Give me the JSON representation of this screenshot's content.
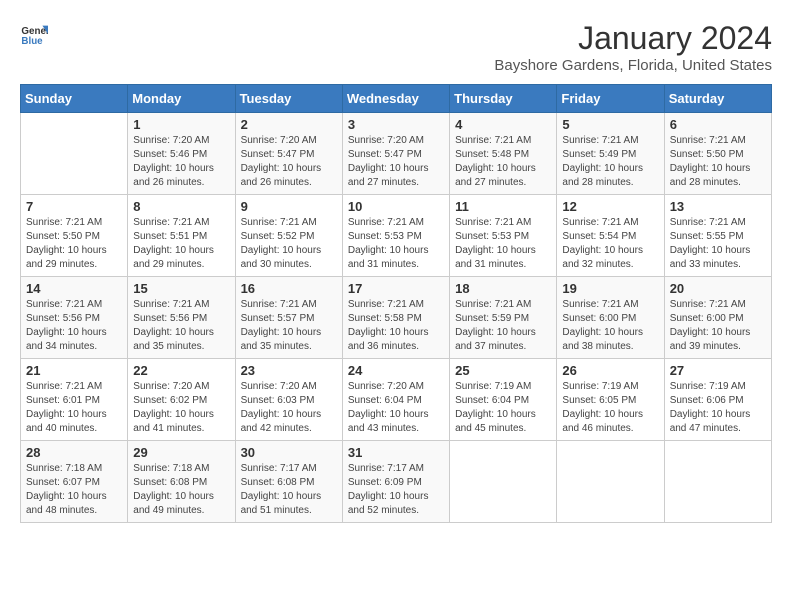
{
  "header": {
    "logo_general": "General",
    "logo_blue": "Blue",
    "month": "January 2024",
    "location": "Bayshore Gardens, Florida, United States"
  },
  "weekdays": [
    "Sunday",
    "Monday",
    "Tuesday",
    "Wednesday",
    "Thursday",
    "Friday",
    "Saturday"
  ],
  "weeks": [
    [
      {
        "day": "",
        "info": ""
      },
      {
        "day": "1",
        "info": "Sunrise: 7:20 AM\nSunset: 5:46 PM\nDaylight: 10 hours\nand 26 minutes."
      },
      {
        "day": "2",
        "info": "Sunrise: 7:20 AM\nSunset: 5:47 PM\nDaylight: 10 hours\nand 26 minutes."
      },
      {
        "day": "3",
        "info": "Sunrise: 7:20 AM\nSunset: 5:47 PM\nDaylight: 10 hours\nand 27 minutes."
      },
      {
        "day": "4",
        "info": "Sunrise: 7:21 AM\nSunset: 5:48 PM\nDaylight: 10 hours\nand 27 minutes."
      },
      {
        "day": "5",
        "info": "Sunrise: 7:21 AM\nSunset: 5:49 PM\nDaylight: 10 hours\nand 28 minutes."
      },
      {
        "day": "6",
        "info": "Sunrise: 7:21 AM\nSunset: 5:50 PM\nDaylight: 10 hours\nand 28 minutes."
      }
    ],
    [
      {
        "day": "7",
        "info": "Sunrise: 7:21 AM\nSunset: 5:50 PM\nDaylight: 10 hours\nand 29 minutes."
      },
      {
        "day": "8",
        "info": "Sunrise: 7:21 AM\nSunset: 5:51 PM\nDaylight: 10 hours\nand 29 minutes."
      },
      {
        "day": "9",
        "info": "Sunrise: 7:21 AM\nSunset: 5:52 PM\nDaylight: 10 hours\nand 30 minutes."
      },
      {
        "day": "10",
        "info": "Sunrise: 7:21 AM\nSunset: 5:53 PM\nDaylight: 10 hours\nand 31 minutes."
      },
      {
        "day": "11",
        "info": "Sunrise: 7:21 AM\nSunset: 5:53 PM\nDaylight: 10 hours\nand 31 minutes."
      },
      {
        "day": "12",
        "info": "Sunrise: 7:21 AM\nSunset: 5:54 PM\nDaylight: 10 hours\nand 32 minutes."
      },
      {
        "day": "13",
        "info": "Sunrise: 7:21 AM\nSunset: 5:55 PM\nDaylight: 10 hours\nand 33 minutes."
      }
    ],
    [
      {
        "day": "14",
        "info": "Sunrise: 7:21 AM\nSunset: 5:56 PM\nDaylight: 10 hours\nand 34 minutes."
      },
      {
        "day": "15",
        "info": "Sunrise: 7:21 AM\nSunset: 5:56 PM\nDaylight: 10 hours\nand 35 minutes."
      },
      {
        "day": "16",
        "info": "Sunrise: 7:21 AM\nSunset: 5:57 PM\nDaylight: 10 hours\nand 35 minutes."
      },
      {
        "day": "17",
        "info": "Sunrise: 7:21 AM\nSunset: 5:58 PM\nDaylight: 10 hours\nand 36 minutes."
      },
      {
        "day": "18",
        "info": "Sunrise: 7:21 AM\nSunset: 5:59 PM\nDaylight: 10 hours\nand 37 minutes."
      },
      {
        "day": "19",
        "info": "Sunrise: 7:21 AM\nSunset: 6:00 PM\nDaylight: 10 hours\nand 38 minutes."
      },
      {
        "day": "20",
        "info": "Sunrise: 7:21 AM\nSunset: 6:00 PM\nDaylight: 10 hours\nand 39 minutes."
      }
    ],
    [
      {
        "day": "21",
        "info": "Sunrise: 7:21 AM\nSunset: 6:01 PM\nDaylight: 10 hours\nand 40 minutes."
      },
      {
        "day": "22",
        "info": "Sunrise: 7:20 AM\nSunset: 6:02 PM\nDaylight: 10 hours\nand 41 minutes."
      },
      {
        "day": "23",
        "info": "Sunrise: 7:20 AM\nSunset: 6:03 PM\nDaylight: 10 hours\nand 42 minutes."
      },
      {
        "day": "24",
        "info": "Sunrise: 7:20 AM\nSunset: 6:04 PM\nDaylight: 10 hours\nand 43 minutes."
      },
      {
        "day": "25",
        "info": "Sunrise: 7:19 AM\nSunset: 6:04 PM\nDaylight: 10 hours\nand 45 minutes."
      },
      {
        "day": "26",
        "info": "Sunrise: 7:19 AM\nSunset: 6:05 PM\nDaylight: 10 hours\nand 46 minutes."
      },
      {
        "day": "27",
        "info": "Sunrise: 7:19 AM\nSunset: 6:06 PM\nDaylight: 10 hours\nand 47 minutes."
      }
    ],
    [
      {
        "day": "28",
        "info": "Sunrise: 7:18 AM\nSunset: 6:07 PM\nDaylight: 10 hours\nand 48 minutes."
      },
      {
        "day": "29",
        "info": "Sunrise: 7:18 AM\nSunset: 6:08 PM\nDaylight: 10 hours\nand 49 minutes."
      },
      {
        "day": "30",
        "info": "Sunrise: 7:17 AM\nSunset: 6:08 PM\nDaylight: 10 hours\nand 51 minutes."
      },
      {
        "day": "31",
        "info": "Sunrise: 7:17 AM\nSunset: 6:09 PM\nDaylight: 10 hours\nand 52 minutes."
      },
      {
        "day": "",
        "info": ""
      },
      {
        "day": "",
        "info": ""
      },
      {
        "day": "",
        "info": ""
      }
    ]
  ]
}
